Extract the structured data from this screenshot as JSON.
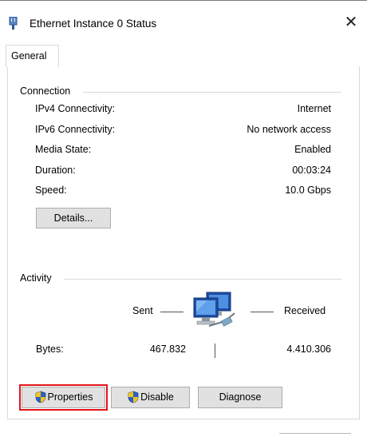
{
  "window": {
    "title": "Ethernet Instance 0 Status",
    "close_glyph": "✕"
  },
  "tabs": [
    {
      "label": "General",
      "selected": true
    }
  ],
  "connection": {
    "heading": "Connection",
    "rows": [
      {
        "label": "IPv4 Connectivity:",
        "value": "Internet"
      },
      {
        "label": "IPv6 Connectivity:",
        "value": "No network access"
      },
      {
        "label": "Media State:",
        "value": "Enabled"
      },
      {
        "label": "Duration:",
        "value": "00:03:24"
      },
      {
        "label": "Speed:",
        "value": "10.0 Gbps"
      }
    ],
    "details_button": "Details..."
  },
  "activity": {
    "heading": "Activity",
    "sent_label": "Sent",
    "received_label": "Received",
    "bytes_label": "Bytes:",
    "bytes_sent": "467.832",
    "bytes_received": "4.410.306",
    "icon": "network-computers-icon"
  },
  "buttons": {
    "properties": "Properties",
    "disable": "Disable",
    "diagnose": "Diagnose"
  },
  "colors": {
    "highlight": "#e3141b",
    "button_bg": "#e1e1e1",
    "button_border": "#adadad"
  }
}
